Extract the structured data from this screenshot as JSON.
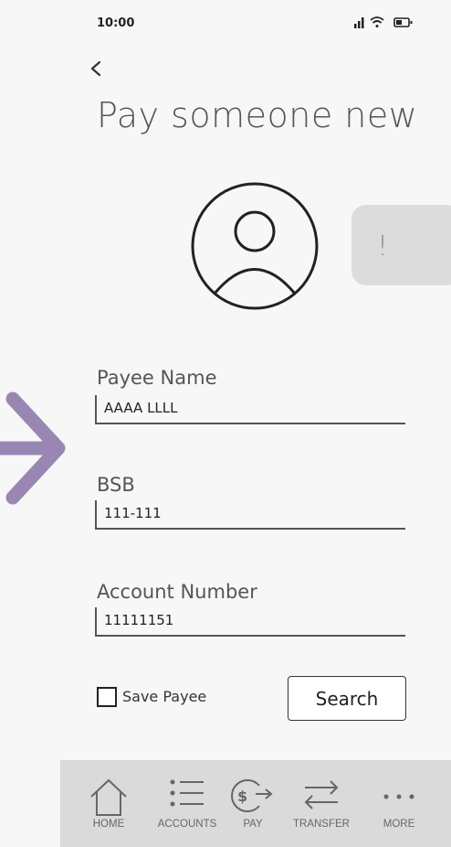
{
  "status_bar": {
    "time": "10:00"
  },
  "header": {
    "title": "Pay someone new"
  },
  "alert_tab": {
    "text": "!"
  },
  "form": {
    "payee_name": {
      "label": "Payee Name",
      "value": "AAAA LLLL"
    },
    "bsb": {
      "label": "BSB",
      "value": "111-111"
    },
    "account_number": {
      "label": "Account Number",
      "value": "11111151"
    },
    "save_payee": {
      "label": "Save Payee",
      "checked": false
    },
    "search_button": {
      "label": "Search"
    }
  },
  "nav": {
    "items": [
      {
        "label": "HOME",
        "icon": "home-icon"
      },
      {
        "label": "ACCOUNTS",
        "icon": "list-icon"
      },
      {
        "label": "PAY",
        "icon": "pay-icon"
      },
      {
        "label": "TRANSFER",
        "icon": "transfer-icon"
      },
      {
        "label": "MORE",
        "icon": "more-icon"
      }
    ]
  },
  "colors": {
    "accent_arrow": "#9a86b3",
    "nav_bg": "#dadada",
    "alert_bg": "#dcdcdc"
  }
}
